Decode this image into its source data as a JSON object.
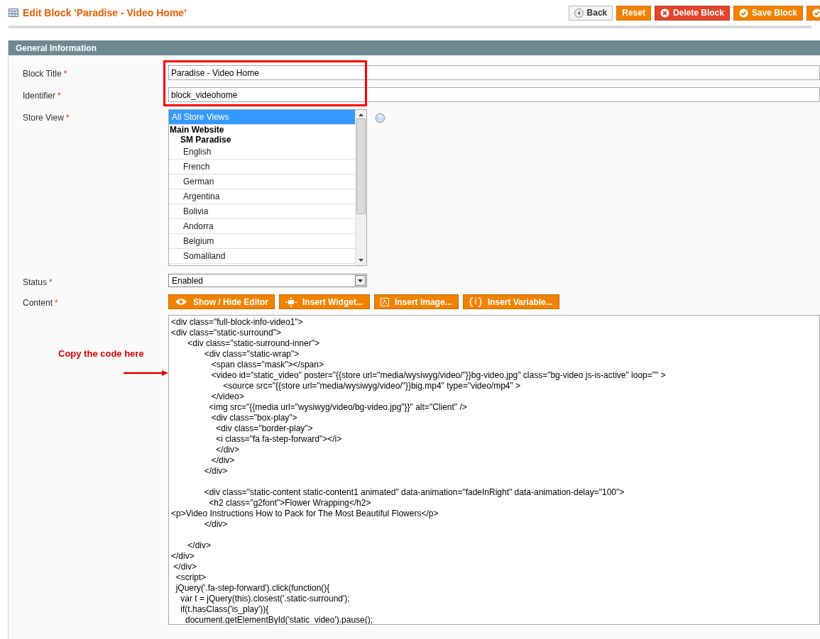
{
  "page_title": "Edit Block 'Paradise - Video Home'",
  "actions": [
    {
      "label": "Back",
      "kind": "back"
    },
    {
      "label": "Reset",
      "kind": "plain"
    },
    {
      "label": "Delete Block",
      "kind": "delete"
    },
    {
      "label": "Save Block",
      "kind": "save"
    },
    {
      "kind": "cut"
    }
  ],
  "section_title": "General Information",
  "fields": {
    "block_title": {
      "label": "Block Title",
      "required_mark": "*",
      "value": "Paradise - Video Home"
    },
    "identifier": {
      "label": "Identifier",
      "required_mark": "*",
      "value": "block_videohome"
    },
    "store_view": {
      "label": "Store View",
      "required_mark": "*",
      "options": [
        {
          "label": "All Store Views",
          "kind": "option",
          "selected": true
        },
        {
          "label": "Main Website",
          "kind": "group",
          "selected": false,
          "children": [
            {
              "label": "SM Paradise",
              "kind": "group",
              "selected": false,
              "children": [
                {
                  "label": "English",
                  "kind": "option",
                  "selected": false
                },
                {
                  "label": "French",
                  "kind": "option",
                  "selected": false
                },
                {
                  "label": "German",
                  "kind": "option",
                  "selected": false
                },
                {
                  "label": "Argentina",
                  "kind": "option",
                  "selected": false
                },
                {
                  "label": "Bolivia",
                  "kind": "option",
                  "selected": false
                },
                {
                  "label": "Andorra",
                  "kind": "option",
                  "selected": false
                },
                {
                  "label": "Belgium",
                  "kind": "option",
                  "selected": false
                },
                {
                  "label": "Somaliland",
                  "kind": "option",
                  "selected": false
                }
              ]
            }
          ]
        }
      ]
    },
    "status": {
      "label": "Status",
      "required_mark": "*",
      "value": "Enabled"
    },
    "content": {
      "label": "Content",
      "required_mark": "*",
      "buttons": [
        {
          "label": "Show / Hide Editor",
          "kind": "eye"
        },
        {
          "label": "Insert Widget...",
          "kind": "widget"
        },
        {
          "label": "Insert Image...",
          "kind": "image"
        },
        {
          "label": "Insert Variable...",
          "kind": "variable"
        }
      ],
      "code_lines": [
        {
          "kind": "code",
          "text": "<div class=\"full-block-info-video1\">"
        },
        {
          "kind": "code",
          "text": "<div class=\"static-surround\">"
        },
        {
          "kind": "code",
          "text": "       <div class=\"static-surround-inner\">"
        },
        {
          "kind": "code",
          "text": "              <div class=\"static-wrap\">"
        },
        {
          "kind": "code",
          "text": "                 <span class=\"mask\"></span>"
        },
        {
          "kind": "code",
          "text": "                 <video id=\"static_video\" poster=\"{{store url=\"media/wysiwyg/video/\"}}bg-video.jpg\" class=\"bg-video js-is-active\" loop=\"\" >"
        },
        {
          "kind": "code",
          "text": "                      <source src=\"{{store url=\"media/wysiwyg/video/\"}}big.mp4\" type=\"video/mp4\" >"
        },
        {
          "kind": "code",
          "text": "                 </video>"
        },
        {
          "kind": "code",
          "text": "                <img src=\"{{media url=\"wysiwyg/video/bg-video.jpg\"}}\" alt=\"Client\" />"
        },
        {
          "kind": "code",
          "text": "                 <div class=\"box-play\">"
        },
        {
          "kind": "code",
          "text": "                   <div class=\"border-play\">"
        },
        {
          "kind": "code",
          "text": "                   <i class=\"fa fa-step-forward\"></i>"
        },
        {
          "kind": "code",
          "text": "                   </div>"
        },
        {
          "kind": "code",
          "text": "                 </div>"
        },
        {
          "kind": "code",
          "text": "              </div>"
        },
        {
          "kind": "blank"
        },
        {
          "kind": "code",
          "text": "              <div class=\"static-content static-content1 animated\" data-animation=\"fadeInRight\" data-animation-delay=\"100\">"
        },
        {
          "kind": "code",
          "text": "                <h2 class=\"g2font\">Flower Wrapping</h2>"
        },
        {
          "kind": "code",
          "text": "<p>Video Instructions How to Pack for The Most Beautiful Flowers</p>"
        },
        {
          "kind": "code",
          "text": "              </div>"
        },
        {
          "kind": "blank"
        },
        {
          "kind": "code",
          "text": "       </div>"
        },
        {
          "kind": "code",
          "text": "</div>"
        },
        {
          "kind": "code",
          "text": " </div>"
        },
        {
          "kind": "code",
          "text": "  <script>"
        },
        {
          "kind": "code",
          "text": "  jQuery('.fa-step-forward').click(function(){"
        },
        {
          "kind": "code",
          "text": "    var t = jQuery(this).closest('.static-surround');"
        },
        {
          "kind": "code",
          "text": "    if(t.hasClass('is_play')){"
        },
        {
          "kind": "code",
          "text": "      document.getElementById('static_video').pause();"
        }
      ]
    }
  },
  "annotation": {
    "text": "Copy the code here"
  }
}
